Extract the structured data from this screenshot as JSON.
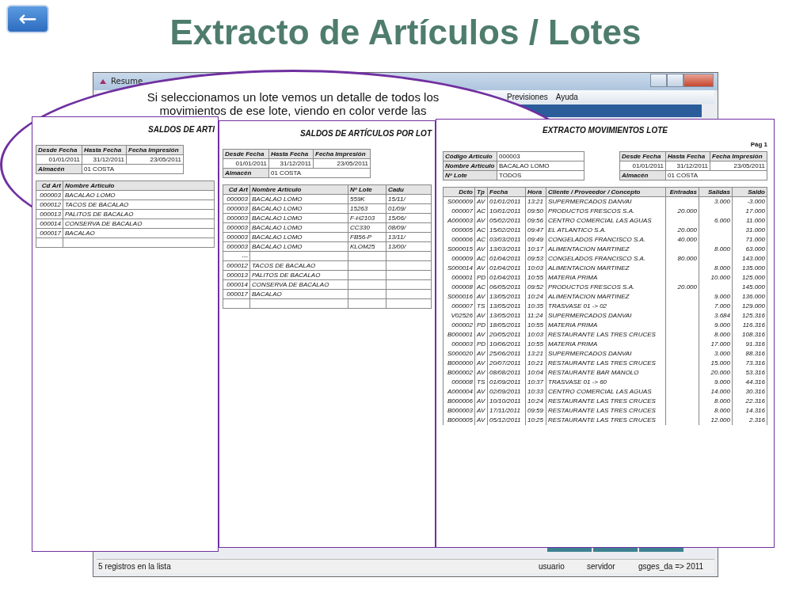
{
  "back_button": {
    "label": "←"
  },
  "slide_title": "Extracto de Artículos / Lotes",
  "window": {
    "title": "Resume",
    "menu": [
      "Previsiones",
      "Ayuda"
    ],
    "status_bar": [
      "5 registros en la lista",
      "usuario",
      "servidor",
      "gsges_da => 2011"
    ]
  },
  "callout": {
    "text": "Si seleccionamos un lote vemos un detalle de todos los movimientos de ese lote, viendo en color verde las"
  },
  "reports": [
    {
      "title": "SALDOS DE ARTI",
      "params": {
        "labels": [
          "Desde Fecha",
          "Hasta Fecha",
          "Fecha Impresión"
        ],
        "values": [
          "01/01/2011",
          "31/12/2011",
          "23/05/2011"
        ],
        "almacen_label": "Almacén",
        "almacen": "01 COSTA"
      },
      "columns": [
        "Cd Art",
        "Nombre Artículo"
      ],
      "rows": [
        {
          "kind": "data",
          "cells": [
            "000003",
            "BACALAO LOMO"
          ]
        },
        {
          "kind": "data",
          "cells": [
            "000012",
            "TACOS DE BACALAO"
          ]
        },
        {
          "kind": "data",
          "cells": [
            "000013",
            "PALITOS DE BACALAO"
          ]
        },
        {
          "kind": "data",
          "cells": [
            "000014",
            "CONSERVA DE BACALAO"
          ]
        },
        {
          "kind": "data",
          "cells": [
            "000017",
            "BACALAO"
          ]
        },
        {
          "kind": "blank"
        }
      ]
    },
    {
      "title": "SALDOS DE ARTÍCULOS POR LOT",
      "params": {
        "labels": [
          "Desde Fecha",
          "Hasta Fecha",
          "Fecha Impresión"
        ],
        "values": [
          "01/01/2011",
          "31/12/2011",
          "23/05/2011"
        ],
        "almacen_label": "Almacén",
        "almacen": "01 COSTA"
      },
      "columns": [
        "Cd Art",
        "Nombre Artículo",
        "Nº Lote",
        "Cadu"
      ],
      "rows": [
        {
          "kind": "data",
          "cells": [
            "000003",
            "BACALAO LOMO",
            "559K",
            "15/11/"
          ]
        },
        {
          "kind": "data",
          "cells": [
            "000003",
            "BACALAO LOMO",
            "15263",
            "01/09/"
          ]
        },
        {
          "kind": "data",
          "cells": [
            "000003",
            "BACALAO LOMO",
            "F-H2103",
            "15/06/"
          ]
        },
        {
          "kind": "data",
          "cells": [
            "000003",
            "BACALAO LOMO",
            "CC330",
            "08/09/"
          ]
        },
        {
          "kind": "data",
          "cells": [
            "000003",
            "BACALAO LOMO",
            "FB56-P",
            "13/11/"
          ]
        },
        {
          "kind": "data",
          "cells": [
            "000003",
            "BACALAO LOMO",
            "KLOM25",
            "13/00/"
          ]
        },
        {
          "kind": "data",
          "cells": [
            "---"
          ]
        },
        {
          "kind": "data",
          "cells": [
            "000012",
            "TACOS DE BACALAO"
          ]
        },
        {
          "kind": "data",
          "cells": [
            "000013",
            "PALITOS DE BACALAO"
          ]
        },
        {
          "kind": "data",
          "cells": [
            "000014",
            "CONSERVA DE BACALAO"
          ]
        },
        {
          "kind": "data",
          "cells": [
            "000017",
            "BACALAO"
          ]
        },
        {
          "kind": "blank"
        }
      ]
    }
  ],
  "extracto": {
    "title": "EXTRACTO MOVIMIENTOS LOTE",
    "page": "Pág 1",
    "info": [
      {
        "label": "Código Artículo",
        "value": "000003"
      },
      {
        "label": "Nombre Artículo",
        "value": "BACALAO LOMO"
      },
      {
        "label": "Nº Lote",
        "value": "TODOS"
      }
    ],
    "params": {
      "labels": [
        "Desde Fecha",
        "Hasta Fecha",
        "Fecha Impresión"
      ],
      "values": [
        "01/01/2011",
        "31/12/2011",
        "23/05/2011"
      ],
      "almacen_label": "Almacén",
      "almacen": "01 COSTA"
    },
    "columns": [
      "Dcto",
      "Tp",
      "Fecha",
      "Hora",
      "Cliente / Proveedor / Concepto",
      "Entradas",
      "Salidas",
      "Saldo"
    ],
    "rows": [
      {
        "dcto": "S000009",
        "tp": "AV",
        "fecha": "01/01/2011",
        "hora": "13:21",
        "concepto": "SUPERMERCADOS DANVAI",
        "salidas": "3.000",
        "saldo": "-3.000"
      },
      {
        "dcto": "000007",
        "tp": "AC",
        "fecha": "10/01/2011",
        "hora": "09:50",
        "concepto": "PRODUCTOS FRESCOS S.A.",
        "entradas": "20.000",
        "saldo": "17.000"
      },
      {
        "dcto": "A000003",
        "tp": "AV",
        "fecha": "05/02/2011",
        "hora": "09:56",
        "concepto": "CENTRO COMERCIAL LAS AGUAS",
        "salidas": "6.000",
        "saldo": "11.000"
      },
      {
        "dcto": "000005",
        "tp": "AC",
        "fecha": "15/02/2011",
        "hora": "09:47",
        "concepto": "EL ATLANTICO S.A.",
        "entradas": "20.000",
        "saldo": "31.000"
      },
      {
        "dcto": "000006",
        "tp": "AC",
        "fecha": "03/03/2011",
        "hora": "09:49",
        "concepto": "CONGELADOS FRANCISCO S.A.",
        "entradas": "40.000",
        "saldo": "71.000"
      },
      {
        "dcto": "S000015",
        "tp": "AV",
        "fecha": "13/03/2011",
        "hora": "10:17",
        "concepto": "ALIMENTACION MARTINEZ",
        "salidas": "8.000",
        "saldo": "63.000"
      },
      {
        "dcto": "000009",
        "tp": "AC",
        "fecha": "01/04/2011",
        "hora": "09:53",
        "concepto": "CONGELADOS FRANCISCO S.A.",
        "entradas": "80.000",
        "saldo": "143.000"
      },
      {
        "dcto": "S000014",
        "tp": "AV",
        "fecha": "01/04/2011",
        "hora": "10:03",
        "concepto": "ALIMENTACION MARTINEZ",
        "salidas": "8.000",
        "saldo": "135.000"
      },
      {
        "dcto": "000001",
        "tp": "PD",
        "fecha": "01/04/2011",
        "hora": "10:55",
        "concepto": "MATERIA PRIMA",
        "salidas": "10.000",
        "saldo": "125.000"
      },
      {
        "dcto": "000008",
        "tp": "AC",
        "fecha": "06/05/2011",
        "hora": "09:52",
        "concepto": "PRODUCTOS FRESCOS S.A.",
        "entradas": "20.000",
        "saldo": "145.000"
      },
      {
        "dcto": "S000016",
        "tp": "AV",
        "fecha": "13/05/2011",
        "hora": "10:24",
        "concepto": "ALIMENTACION MARTINEZ",
        "salidas": "9.000",
        "saldo": "136.000"
      },
      {
        "dcto": "000007",
        "tp": "TS",
        "fecha": "13/05/2011",
        "hora": "10:35",
        "concepto": "TRASVASE 01 -> 02",
        "salidas": "7.000",
        "saldo": "129.000"
      },
      {
        "dcto": "V02526",
        "tp": "AV",
        "fecha": "13/05/2011",
        "hora": "11:24",
        "concepto": "SUPERMERCADOS DANVAI",
        "salidas": "3.684",
        "saldo": "125.316"
      },
      {
        "dcto": "000002",
        "tp": "PD",
        "fecha": "18/05/2011",
        "hora": "10:55",
        "concepto": "MATERIA PRIMA",
        "salidas": "9.000",
        "saldo": "116.316"
      },
      {
        "dcto": "B000001",
        "tp": "AV",
        "fecha": "20/05/2011",
        "hora": "10:03",
        "concepto": "RESTAURANTE LAS TRES CRUCES",
        "salidas": "8.000",
        "saldo": "108.316"
      },
      {
        "dcto": "000003",
        "tp": "PD",
        "fecha": "10/06/2011",
        "hora": "10:55",
        "concepto": "MATERIA PRIMA",
        "salidas": "17.000",
        "saldo": "91.316"
      },
      {
        "dcto": "S000020",
        "tp": "AV",
        "fecha": "25/06/2011",
        "hora": "13:21",
        "concepto": "SUPERMERCADOS DANVAI",
        "salidas": "3.000",
        "saldo": "88.316"
      },
      {
        "dcto": "B000000",
        "tp": "AV",
        "fecha": "20/07/2011",
        "hora": "10:21",
        "concepto": "RESTAURANTE LAS TRES CRUCES",
        "salidas": "15.000",
        "saldo": "73.316"
      },
      {
        "dcto": "B000002",
        "tp": "AV",
        "fecha": "08/08/2011",
        "hora": "10:04",
        "concepto": "RESTAURANTE BAR MANOLO",
        "salidas": "20.000",
        "saldo": "53.316"
      },
      {
        "dcto": "000008",
        "tp": "TS",
        "fecha": "01/09/2011",
        "hora": "10:37",
        "concepto": "TRASVASE 01 -> 60",
        "salidas": "9.000",
        "saldo": "44.316"
      },
      {
        "dcto": "A000004",
        "tp": "AV",
        "fecha": "02/09/2011",
        "hora": "10:33",
        "concepto": "CENTRO COMERCIAL LAS AGUAS",
        "salidas": "14.000",
        "saldo": "30.316"
      },
      {
        "dcto": "B000006",
        "tp": "AV",
        "fecha": "10/10/2011",
        "hora": "10:24",
        "concepto": "RESTAURANTE LAS TRES CRUCES",
        "salidas": "8.000",
        "saldo": "22.316"
      },
      {
        "dcto": "B000003",
        "tp": "AV",
        "fecha": "17/11/2011",
        "hora": "09:59",
        "concepto": "RESTAURANTE LAS TRES CRUCES",
        "salidas": "8.000",
        "saldo": "14.316"
      },
      {
        "dcto": "B000005",
        "tp": "AV",
        "fecha": "05/12/2011",
        "hora": "10:25",
        "concepto": "RESTAURANTE LAS TRES CRUCES",
        "salidas": "12.000",
        "saldo": "2.316"
      }
    ]
  }
}
